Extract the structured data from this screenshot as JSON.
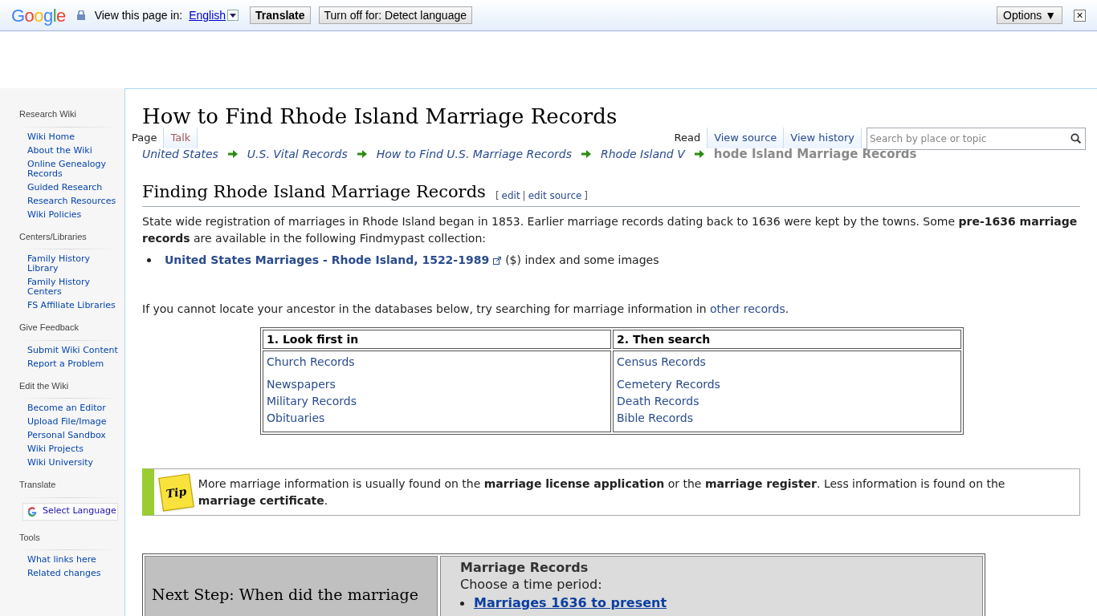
{
  "translate_bar": {
    "brand": "Google",
    "prompt": "View this page in:",
    "language": "English",
    "translate_button": "Translate",
    "turn_off_button": "Turn off for: Detect language",
    "options_button": "Options ▼",
    "close": "×"
  },
  "sidebar": {
    "sections": [
      {
        "heading": "Research Wiki",
        "items": [
          "Wiki Home",
          "About the Wiki",
          "Online Genealogy Records",
          "Guided Research",
          "Research Resources",
          "Wiki Policies"
        ]
      },
      {
        "heading": "Centers/Libraries",
        "items": [
          "Family History Library",
          "Family History Centers",
          "FS Affiliate Libraries"
        ]
      },
      {
        "heading": "Give Feedback",
        "items": [
          "Submit Wiki Content",
          "Report a Problem"
        ]
      },
      {
        "heading": "Edit the Wiki",
        "items": [
          "Become an Editor",
          "Upload File/Image",
          "Personal Sandbox",
          "Wiki Projects",
          "Wiki University"
        ]
      },
      {
        "heading": "Translate",
        "kind": "translate",
        "button": "Select Language"
      },
      {
        "heading": "Tools",
        "items": [
          "What links here",
          "Related changes"
        ]
      }
    ]
  },
  "tabs_left": [
    {
      "label": "Page",
      "selected": true
    },
    {
      "label": "Talk",
      "selected": false
    }
  ],
  "tabs_right": [
    {
      "label": "Read",
      "selected": true
    },
    {
      "label": "View source",
      "selected": false
    },
    {
      "label": "View history",
      "selected": false
    }
  ],
  "search": {
    "placeholder": "Search by place or topic"
  },
  "title": "How to Find Rhode Island Marriage Records",
  "breadcrumb": [
    {
      "label": "United States",
      "current": false
    },
    {
      "label": "U.S. Vital Records",
      "current": false
    },
    {
      "label": "How to Find U.S. Marriage Records",
      "current": false
    },
    {
      "label": "Rhode Island V",
      "current": false
    },
    {
      "label": "hode Island Marriage Records",
      "current": true
    }
  ],
  "section": {
    "heading": "Finding Rhode Island Marriage Records",
    "open_bracket": "[",
    "edit": "edit",
    "separator": "|",
    "edit_source": "edit source",
    "close_bracket": "]"
  },
  "intro": "State wide registration of marriages in Rhode Island began in 1853. Earlier marriage records dating back to 1636 were kept by the towns. Some **pre-1636 marriage records** are available in the following Findmypast collection:",
  "collection": {
    "link": "United States Marriages - Rhode Island, 1522-1989",
    "note": "($) index and some images"
  },
  "search_note": {
    "text": "If you cannot locate your ancestor in the databases below, try searching for marriage information in",
    "link": "other records",
    "end": "."
  },
  "records_table": {
    "columns": [
      "1. Look first in",
      "2. Then search"
    ],
    "column_1": [
      [
        "Church Records"
      ],
      [
        "Newspapers",
        "Military Records",
        "Obituaries"
      ]
    ],
    "column_2": [
      [
        "Census Records"
      ],
      [
        "Cemetery Records",
        "Death Records",
        "Bible Records"
      ]
    ]
  },
  "tip": {
    "badge": "Tip",
    "text": "More marriage information is usually found on the **marriage license application** or the **marriage register**. Less information is found on the **marriage certificate**."
  },
  "next_step": {
    "question": "Next Step: When did the marriage",
    "heading": "Marriage Records",
    "prompt": "Choose a time period:",
    "links": [
      "Marriages 1636 to present"
    ]
  }
}
